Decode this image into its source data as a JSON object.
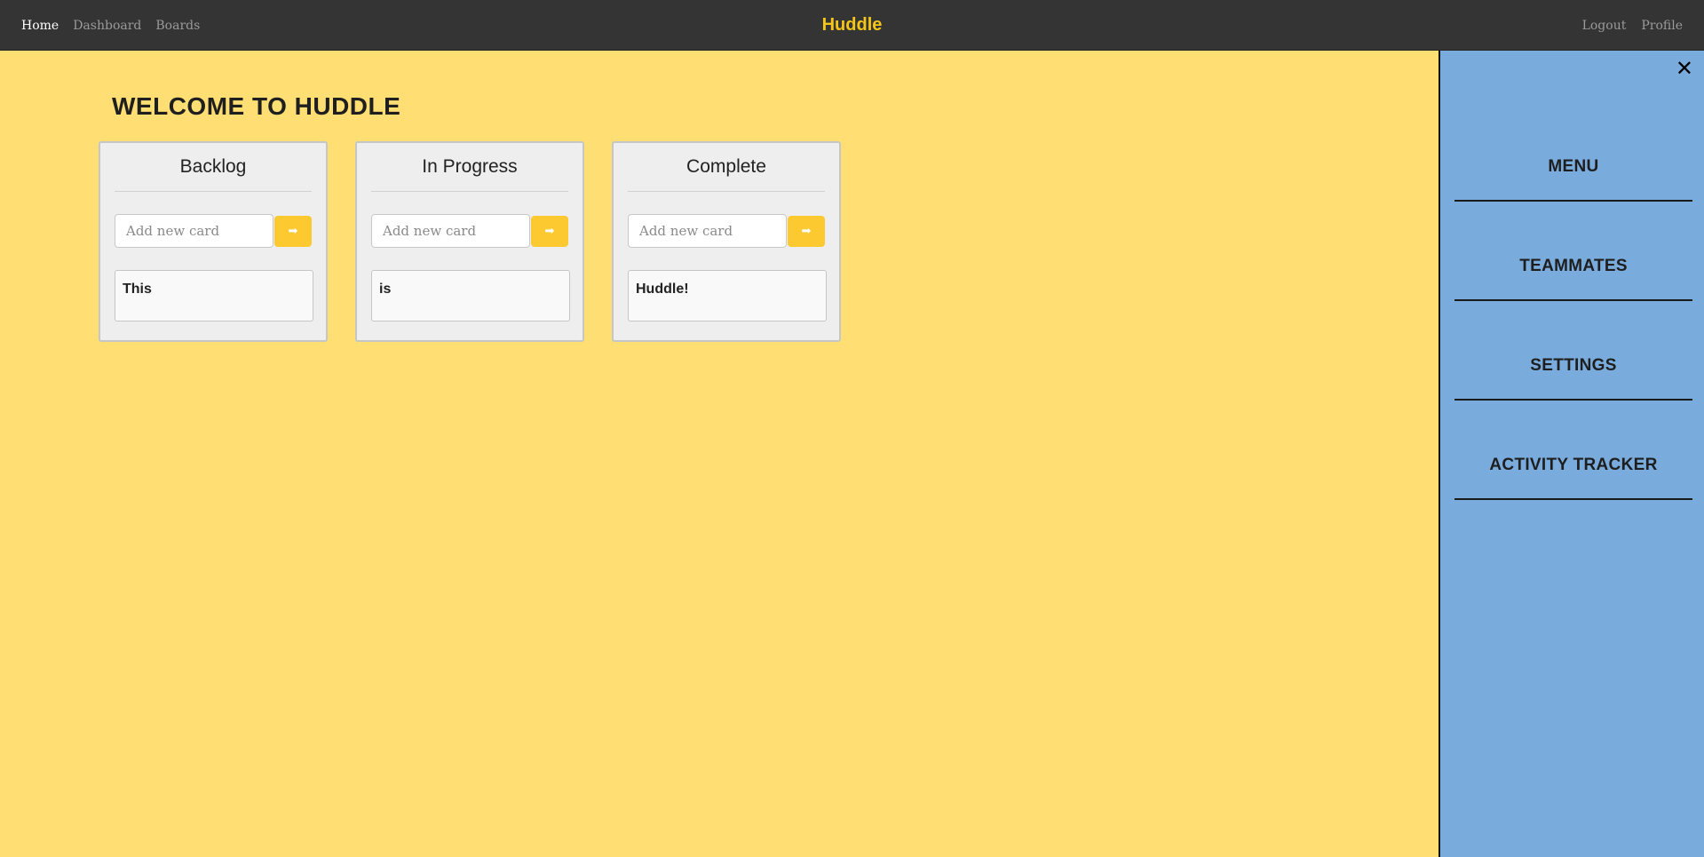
{
  "navbar": {
    "links": [
      "Home",
      "Dashboard",
      "Boards"
    ],
    "brand": "Huddle",
    "right_links": [
      "Logout",
      "Profile"
    ]
  },
  "main": {
    "title": "WELCOME TO HUDDLE",
    "lists": [
      {
        "title": "Backlog",
        "input_placeholder": "Add new card",
        "button_icon": "arrow-right-icon",
        "cards": [
          "This"
        ]
      },
      {
        "title": "In Progress",
        "input_placeholder": "Add new card",
        "button_icon": "arrow-right-icon",
        "cards": [
          "is"
        ]
      },
      {
        "title": "Complete",
        "input_placeholder": "Add new card",
        "button_icon": "arrow-right-icon",
        "cards": [
          "Huddle!"
        ]
      }
    ]
  },
  "sidemenu": {
    "close_icon": "close-icon",
    "items": [
      "MENU",
      "TEAMMATES",
      "SETTINGS",
      "ACTIVITY TRACKER"
    ]
  },
  "colors": {
    "background": "#ffde73",
    "navbar": "#343434",
    "brand": "#f5c518",
    "accent_button": "#fcc931",
    "sidemenu": "#79acdc"
  }
}
